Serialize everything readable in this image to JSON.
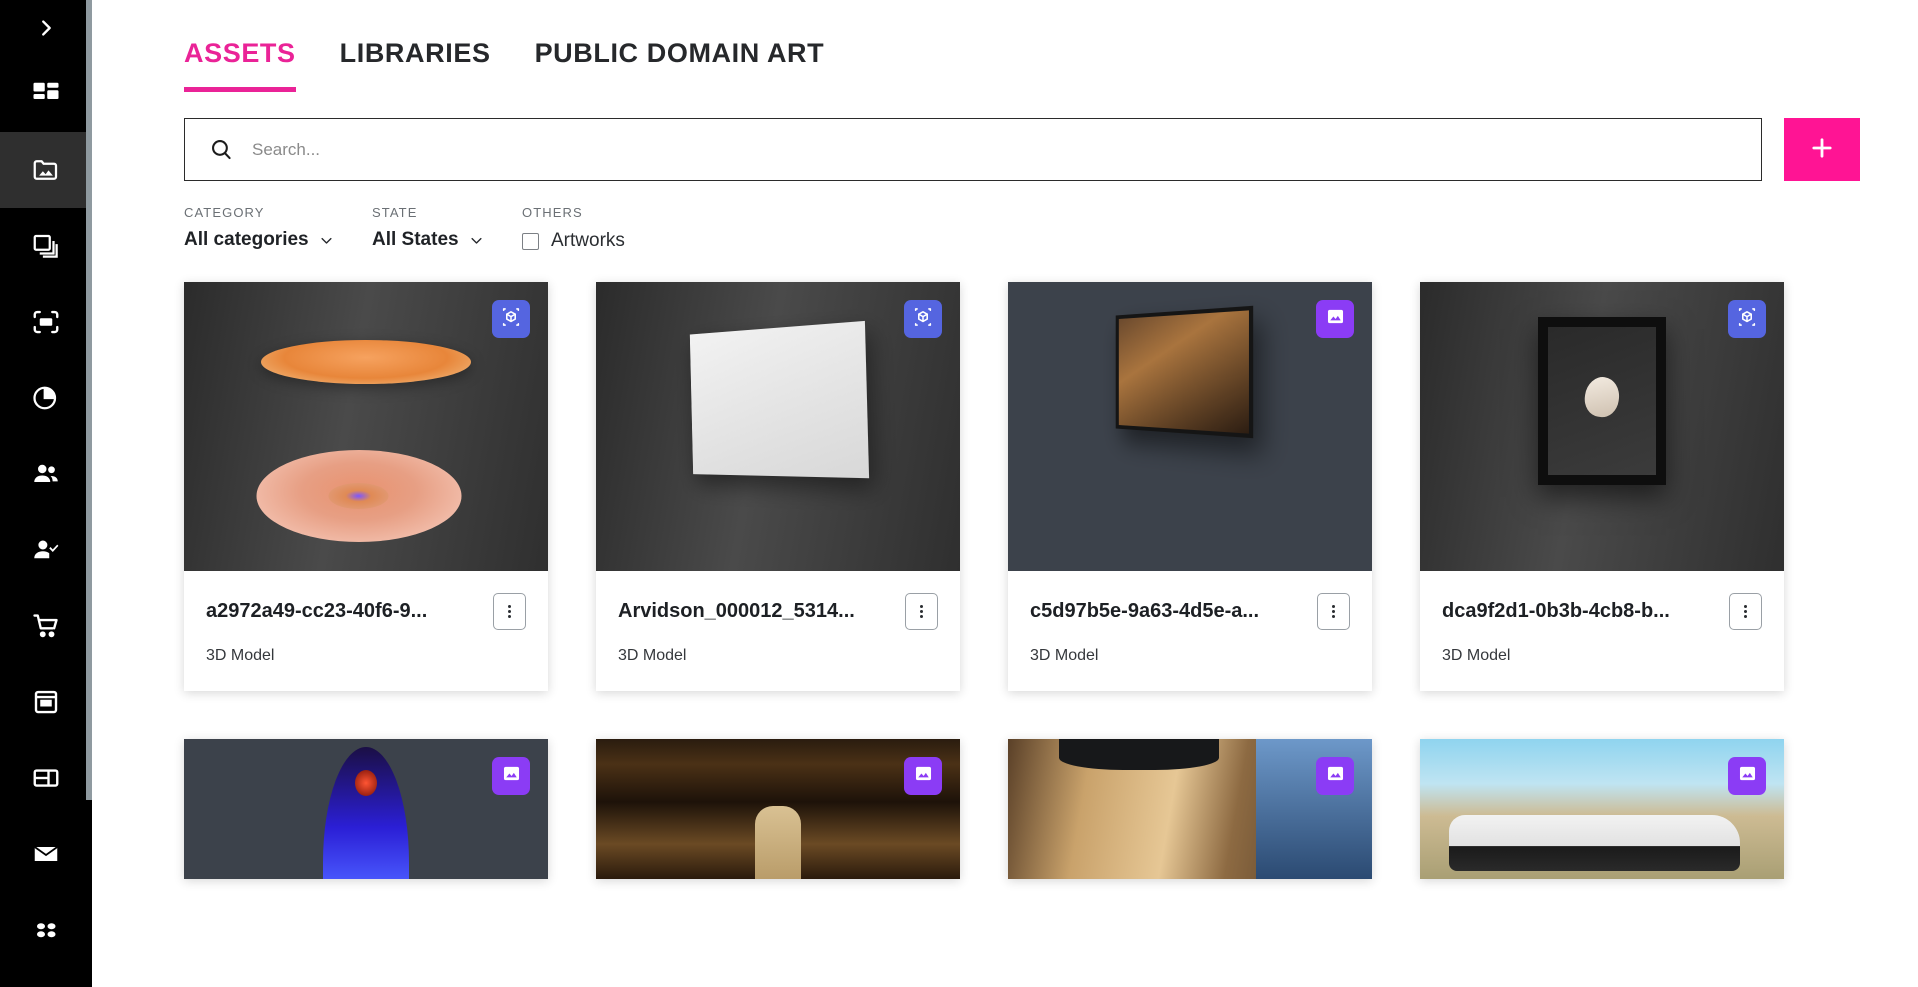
{
  "sidebar": {
    "toggle_icon": "chevron-right-icon",
    "items": [
      {
        "icon": "dashboard-grid-icon",
        "name": "dashboard",
        "active": false
      },
      {
        "icon": "image-folder-icon",
        "name": "assets",
        "active": true
      },
      {
        "icon": "layers-copy-icon",
        "name": "collections",
        "active": false
      },
      {
        "icon": "frame-crop-icon",
        "name": "frames",
        "active": false
      },
      {
        "icon": "pie-chart-icon",
        "name": "analytics",
        "active": false
      },
      {
        "icon": "users-icon",
        "name": "users",
        "active": false
      },
      {
        "icon": "user-check-icon",
        "name": "approvals",
        "active": false
      },
      {
        "icon": "shopping-cart-icon",
        "name": "orders",
        "active": false
      },
      {
        "icon": "archive-box-icon",
        "name": "inventory",
        "active": false
      },
      {
        "icon": "layout-panel-icon",
        "name": "layouts",
        "active": false
      },
      {
        "icon": "envelope-icon",
        "name": "messages",
        "active": false
      },
      {
        "icon": "apps-dots-icon",
        "name": "apps",
        "active": false
      }
    ]
  },
  "tabs": [
    {
      "label": "ASSETS",
      "active": true
    },
    {
      "label": "LIBRARIES",
      "active": false
    },
    {
      "label": "PUBLIC DOMAIN ART",
      "active": false
    }
  ],
  "search": {
    "placeholder": "Search...",
    "value": "",
    "icon": "search-icon"
  },
  "add_button": {
    "label": "+",
    "icon": "plus-icon",
    "color": "#ff1494"
  },
  "filters": {
    "category": {
      "label": "CATEGORY",
      "value": "All categories"
    },
    "state": {
      "label": "STATE",
      "value": "All States"
    },
    "others": {
      "label": "OTHERS",
      "checkbox_label": "Artworks",
      "checked": false
    }
  },
  "colors": {
    "accent": "#ea2397",
    "add_button": "#ff1494",
    "badge_model": "#5565e0",
    "badge_image": "#8b3cf5",
    "sidebar_bg": "#000000",
    "sidebar_active": "#2f2f2f"
  },
  "assets": [
    {
      "title": "a2972a49-cc23-40f6-9...",
      "type": "3D Model",
      "badge": "model",
      "badge_icon": "cube-3d-icon",
      "thumb": "disc"
    },
    {
      "title": "Arvidson_000012_5314...",
      "type": "3D Model",
      "badge": "model",
      "badge_icon": "cube-3d-icon",
      "thumb": "canvas"
    },
    {
      "title": "c5d97b5e-9a63-4d5e-a...",
      "type": "3D Model",
      "badge": "image",
      "badge_icon": "picture-icon",
      "thumb": "tv"
    },
    {
      "title": "dca9f2d1-0b3b-4cb8-b...",
      "type": "3D Model",
      "badge": "model",
      "badge_icon": "cube-3d-icon",
      "thumb": "frame"
    },
    {
      "title": "",
      "type": "",
      "badge": "image",
      "badge_icon": "picture-icon",
      "thumb": "virgin"
    },
    {
      "title": "",
      "type": "",
      "badge": "image",
      "badge_icon": "picture-icon",
      "thumb": "museum"
    },
    {
      "title": "",
      "type": "",
      "badge": "image",
      "badge_icon": "picture-icon",
      "thumb": "hair"
    },
    {
      "title": "",
      "type": "",
      "badge": "image",
      "badge_icon": "picture-icon",
      "thumb": "car"
    }
  ]
}
